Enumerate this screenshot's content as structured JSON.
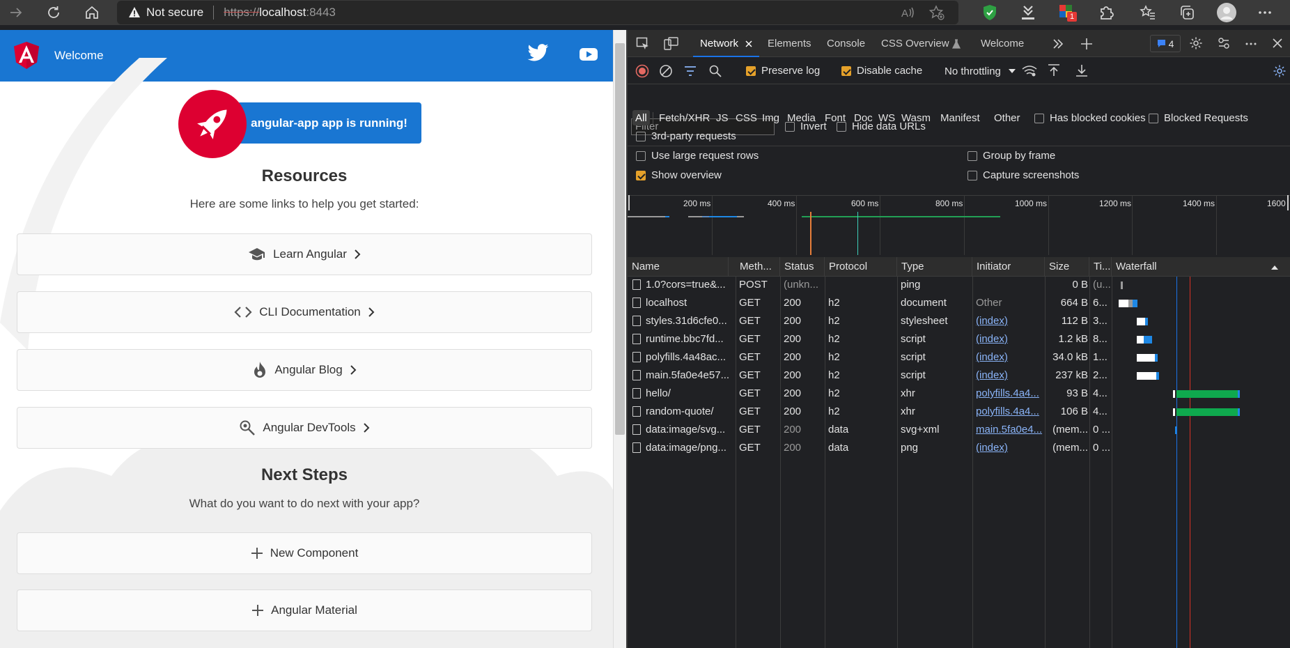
{
  "browser": {
    "security_label": "Not secure",
    "url_scheme": "https://",
    "url_host": "localhost",
    "url_port": ":8443",
    "extension_badge": "1"
  },
  "app": {
    "header_title": "Welcome",
    "running_label": "angular-app app is running!",
    "resources_title": "Resources",
    "resources_sub": "Here are some links to help you get started:",
    "resource_cards": [
      "Learn Angular",
      "CLI Documentation",
      "Angular Blog",
      "Angular DevTools"
    ],
    "next_title": "Next Steps",
    "next_sub": "What do you want to do next with your app?",
    "next_cards": [
      "New Component",
      "Angular Material"
    ],
    "colors": {
      "header": "#1976d2",
      "brand_red": "#dd0031"
    }
  },
  "devtools": {
    "tabs": [
      "Network",
      "Elements",
      "Console",
      "CSS Overview",
      "Welcome"
    ],
    "issues_count": "4",
    "preserve_log": "Preserve log",
    "disable_cache": "Disable cache",
    "throttling": "No throttling",
    "filter_placeholder": "Filter",
    "invert": "Invert",
    "hide_data_urls": "Hide data URLs",
    "type_filters": [
      "All",
      "Fetch/XHR",
      "JS",
      "CSS",
      "Img",
      "Media",
      "Font",
      "Doc",
      "WS",
      "Wasm",
      "Manifest",
      "Other"
    ],
    "has_blocked_cookies": "Has blocked cookies",
    "blocked_requests": "Blocked Requests",
    "third_party": "3rd-party requests",
    "use_large_rows": "Use large request rows",
    "group_by_frame": "Group by frame",
    "show_overview": "Show overview",
    "capture_screenshots": "Capture screenshots",
    "timeline_labels": [
      "200 ms",
      "400 ms",
      "600 ms",
      "800 ms",
      "1000 ms",
      "1200 ms",
      "1400 ms",
      "1600"
    ],
    "columns": [
      "Name",
      "Meth...",
      "Status",
      "Protocol",
      "Type",
      "Initiator",
      "Size",
      "Ti...",
      "Waterfall"
    ],
    "rows": [
      {
        "name": "1.0?cors=true&...",
        "method": "POST",
        "status": "(unkn...",
        "protocol": "",
        "type": "ping",
        "initiator": "",
        "size": "0 B",
        "time": "(u..."
      },
      {
        "name": "localhost",
        "method": "GET",
        "status": "200",
        "protocol": "h2",
        "type": "document",
        "initiator": "Other",
        "size": "664 B",
        "time": "6..."
      },
      {
        "name": "styles.31d6cfe0...",
        "method": "GET",
        "status": "200",
        "protocol": "h2",
        "type": "stylesheet",
        "initiator": "(index)",
        "size": "112 B",
        "time": "3..."
      },
      {
        "name": "runtime.bbc7fd...",
        "method": "GET",
        "status": "200",
        "protocol": "h2",
        "type": "script",
        "initiator": "(index)",
        "size": "1.2 kB",
        "time": "8..."
      },
      {
        "name": "polyfills.4a48ac...",
        "method": "GET",
        "status": "200",
        "protocol": "h2",
        "type": "script",
        "initiator": "(index)",
        "size": "34.0 kB",
        "time": "1..."
      },
      {
        "name": "main.5fa0e4e57...",
        "method": "GET",
        "status": "200",
        "protocol": "h2",
        "type": "script",
        "initiator": "(index)",
        "size": "237 kB",
        "time": "2..."
      },
      {
        "name": "hello/",
        "method": "GET",
        "status": "200",
        "protocol": "h2",
        "type": "xhr",
        "initiator": "polyfills.4a4...",
        "size": "93 B",
        "time": "4..."
      },
      {
        "name": "random-quote/",
        "method": "GET",
        "status": "200",
        "protocol": "h2",
        "type": "xhr",
        "initiator": "polyfills.4a4...",
        "size": "106 B",
        "time": "4..."
      },
      {
        "name": "data:image/svg...",
        "method": "GET",
        "status": "200",
        "protocol": "data",
        "type": "svg+xml",
        "initiator": "main.5fa0e4...",
        "size": "(mem...",
        "time": "0 ..."
      },
      {
        "name": "data:image/png...",
        "method": "GET",
        "status": "200",
        "protocol": "data",
        "type": "png",
        "initiator": "(index)",
        "size": "(mem...",
        "time": "0 ..."
      }
    ]
  }
}
